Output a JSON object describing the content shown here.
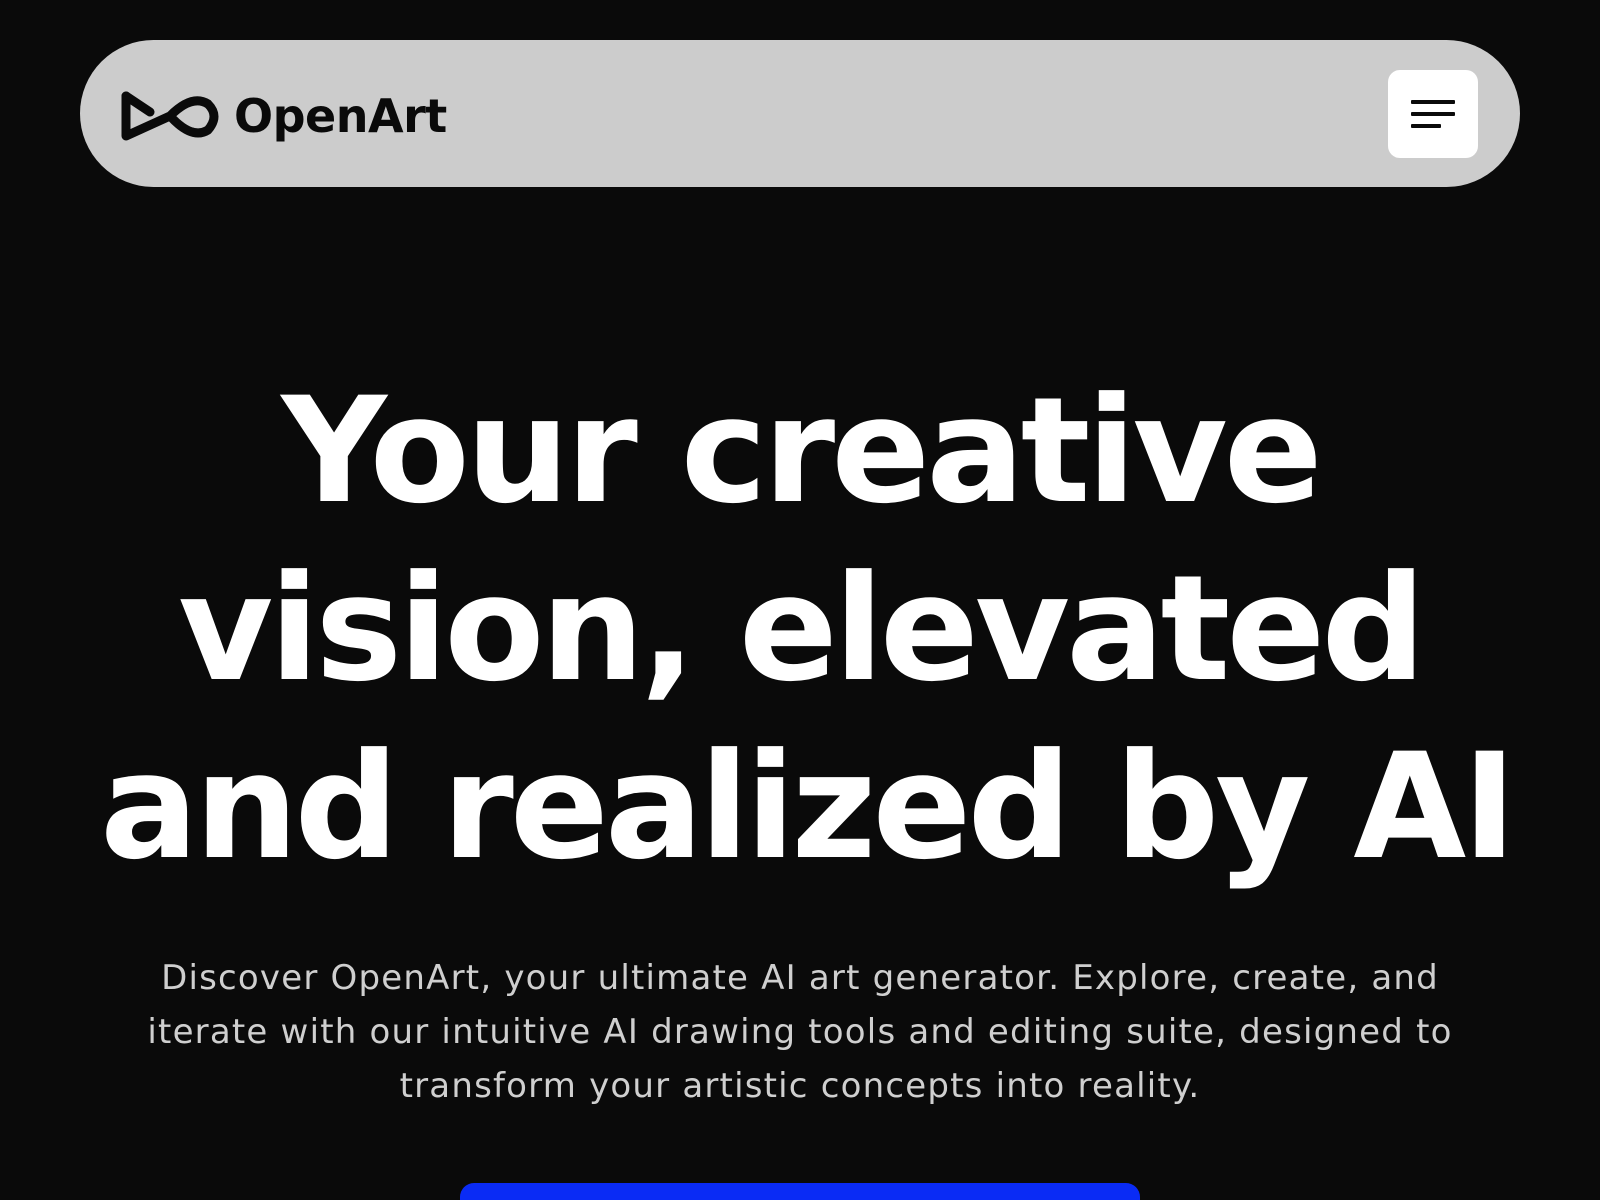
{
  "brand": {
    "name": "OpenArt",
    "logo_icon": "infinity-logo-icon"
  },
  "header": {
    "menu_icon": "hamburger-menu-icon"
  },
  "hero": {
    "title_lines": [
      "Your creative",
      "vision, elevated",
      "and realized by AI"
    ],
    "subtitle_lines": [
      "Discover OpenArt, your ultimate AI art generator. Explore, create, and",
      "iterate with our intuitive AI drawing tools and editing suite, designed to",
      "transform your artistic concepts into reality."
    ]
  },
  "colors": {
    "background": "#0a0a0a",
    "navbar": "#cccccc",
    "menu_button": "#ffffff",
    "title_text": "#ffffff",
    "subtitle_text": "#cfcfcf",
    "cta": "#0a2bf5"
  }
}
